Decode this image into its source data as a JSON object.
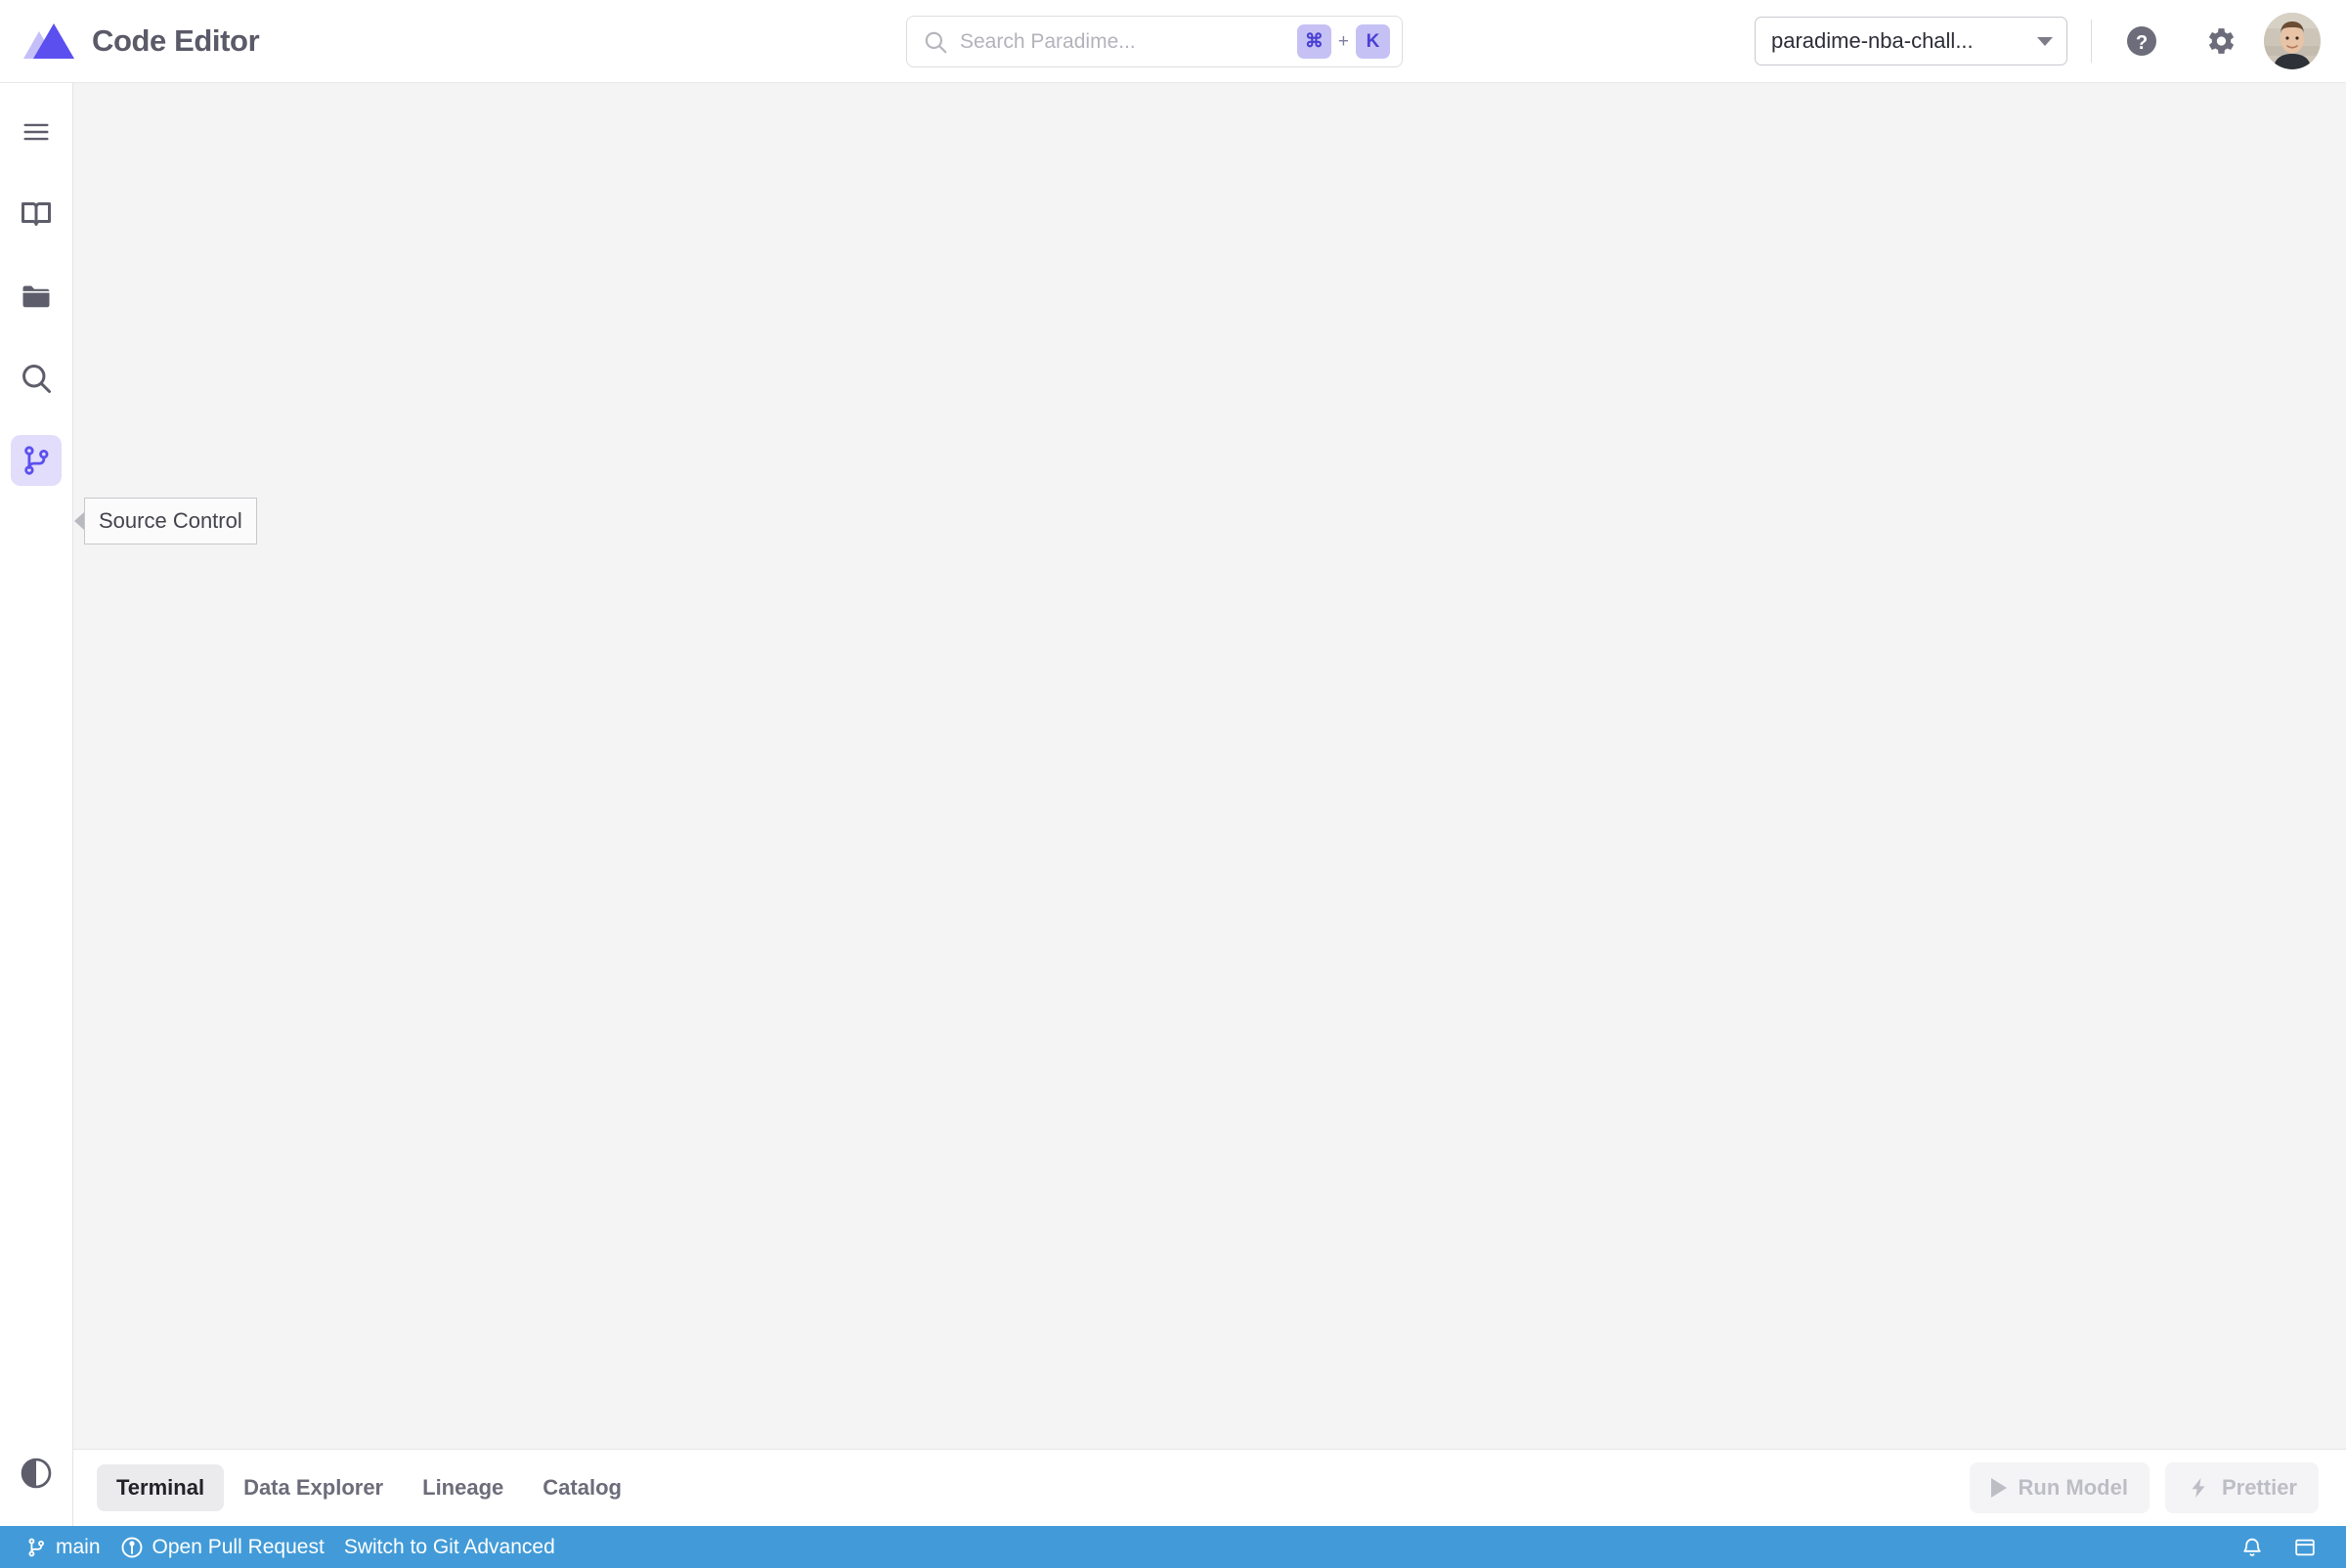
{
  "app": {
    "title": "Code Editor",
    "logo_icon": "paradime-triangle-logo",
    "brand_purple": "#5b4ff0"
  },
  "search": {
    "placeholder": "Search Paradime...",
    "value": "",
    "icon": "search-icon",
    "shortcut_key_modifier": "⌘",
    "shortcut_plus": "+",
    "shortcut_key": "K"
  },
  "topbar": {
    "workspace": {
      "label": "paradime-nba-chall...",
      "caret_icon": "chevron-down-icon"
    },
    "help_icon": "help-circle-icon",
    "settings_icon": "gear-icon",
    "avatar_icon": "user-avatar"
  },
  "rail": {
    "items": [
      {
        "name": "menu",
        "label": "Menu",
        "icon": "hamburger-menu-icon",
        "active": false
      },
      {
        "name": "docs",
        "label": "Docs",
        "icon": "book-icon",
        "active": false
      },
      {
        "name": "files",
        "label": "Files",
        "icon": "folder-icon",
        "active": false
      },
      {
        "name": "search",
        "label": "Search",
        "icon": "search-icon",
        "active": false
      },
      {
        "name": "source-control",
        "label": "Source Control",
        "icon": "git-branch-icon",
        "active": true
      }
    ],
    "theme_toggle": {
      "label": "Toggle Theme",
      "icon": "half-circle-contrast-icon"
    }
  },
  "tooltip": {
    "text": "Source Control",
    "visible": true
  },
  "tabbar": {
    "tabs": [
      {
        "label": "Terminal",
        "active": true
      },
      {
        "label": "Data Explorer",
        "active": false
      },
      {
        "label": "Lineage",
        "active": false
      },
      {
        "label": "Catalog",
        "active": false
      }
    ],
    "run_model": {
      "label": "Run Model",
      "icon": "play-icon",
      "disabled": true
    },
    "prettier": {
      "label": "Prettier",
      "icon": "lightning-bolt-icon",
      "disabled": true
    }
  },
  "statusbar": {
    "background": "#429bd8",
    "branch": {
      "label": "main",
      "icon": "git-branch-icon"
    },
    "pull_request": {
      "label": "Open Pull Request",
      "icon": "pull-request-icon"
    },
    "git_advanced": {
      "label": "Switch to Git Advanced"
    },
    "notifications_icon": "bell-icon",
    "panel_toggle_icon": "layout-panel-icon"
  }
}
